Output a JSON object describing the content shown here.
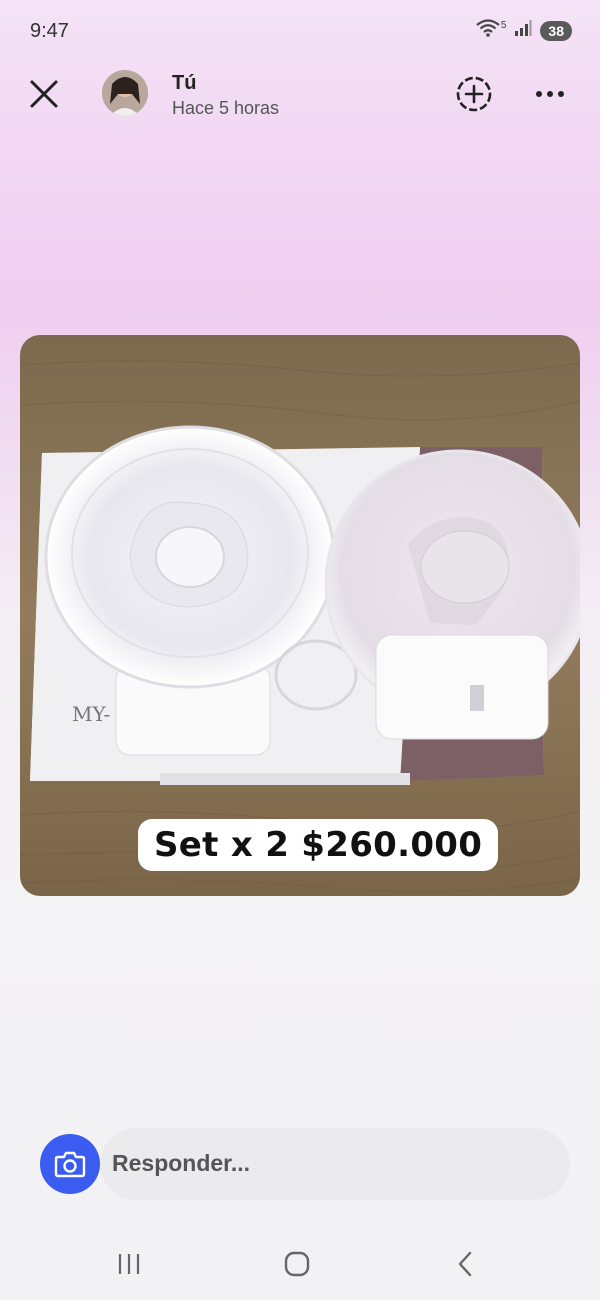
{
  "status_bar": {
    "time": "9:47",
    "wifi_badge": "5",
    "battery": "38",
    "icons": [
      "wifi-icon",
      "signal-icon",
      "battery-icon"
    ]
  },
  "header": {
    "close_icon": "close-icon",
    "username": "Tú",
    "time_ago": "Hace 5 horas",
    "add_icon": "add-story-icon",
    "more_icon": "more-icon"
  },
  "story": {
    "price_text": "Set x 2 $260.000",
    "box_text": "MY-"
  },
  "reply": {
    "camera_icon": "camera-icon",
    "placeholder": "Responder..."
  },
  "nav": {
    "items": [
      "recent-apps-icon",
      "home-icon",
      "back-icon"
    ]
  },
  "colors": {
    "accent": "#3a5cf0",
    "wood": "#8a7558",
    "box": "#f2f2f4"
  }
}
